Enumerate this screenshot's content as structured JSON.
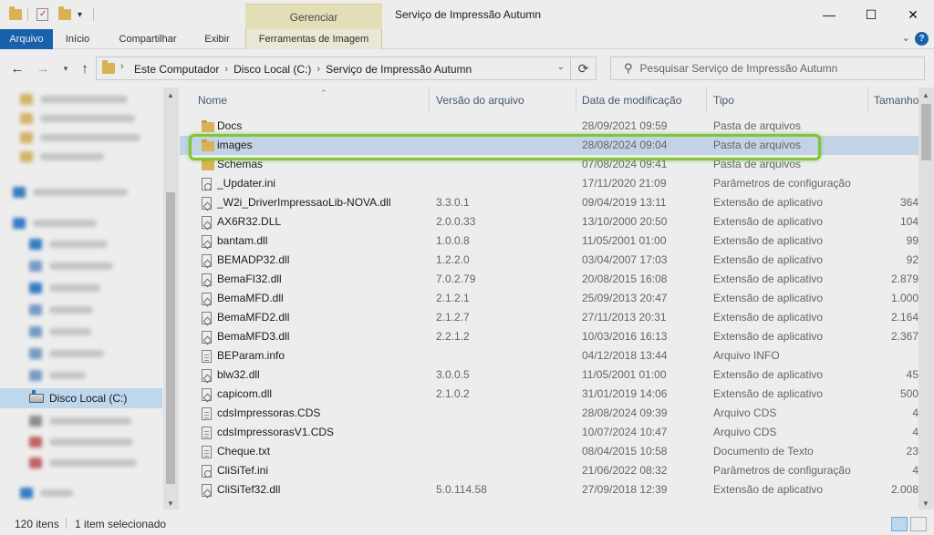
{
  "window": {
    "title": "Serviço de Impressão Autumn",
    "context_group": "Gerenciar",
    "minimize": "—",
    "maximize": "☐",
    "close": "✕"
  },
  "ribbon": {
    "tabs": [
      "Arquivo",
      "Início",
      "Compartilhar",
      "Exibir",
      "Ferramentas de Imagem"
    ],
    "help": "?"
  },
  "address": {
    "crumbs": [
      "Este Computador",
      "Disco Local (C:)",
      "Serviço de Impressão Autumn"
    ]
  },
  "search": {
    "placeholder": "Pesquisar Serviço de Impressão Autumn"
  },
  "sidebar": {
    "selected_item": "Disco Local (C:)"
  },
  "columns": [
    "Nome",
    "Versão do arquivo",
    "Data de modificação",
    "Tipo",
    "Tamanho"
  ],
  "files": [
    {
      "name": "Docs",
      "ver": "",
      "date": "28/09/2021 09:59",
      "type": "Pasta de arquivos",
      "size": "",
      "icon": "folder"
    },
    {
      "name": "images",
      "ver": "",
      "date": "28/08/2024 09:04",
      "type": "Pasta de arquivos",
      "size": "",
      "icon": "folder"
    },
    {
      "name": "Schemas",
      "ver": "",
      "date": "07/08/2024 09:41",
      "type": "Pasta de arquivos",
      "size": "",
      "icon": "folder"
    },
    {
      "name": "_Updater.ini",
      "ver": "",
      "date": "17/11/2020 21:09",
      "type": "Parâmetros de configuração",
      "size": "",
      "icon": "gear"
    },
    {
      "name": "_W2i_DriverImpressaoLib-NOVA.dll",
      "ver": "3.3.0.1",
      "date": "09/04/2019 13:11",
      "type": "Extensão de aplicativo",
      "size": "364",
      "icon": "dll"
    },
    {
      "name": "AX6R32.DLL",
      "ver": "2.0.0.33",
      "date": "13/10/2000 20:50",
      "type": "Extensão de aplicativo",
      "size": "104",
      "icon": "dll"
    },
    {
      "name": "bantam.dll",
      "ver": "1.0.0.8",
      "date": "11/05/2001 01:00",
      "type": "Extensão de aplicativo",
      "size": "99",
      "icon": "dll"
    },
    {
      "name": "BEMADP32.dll",
      "ver": "1.2.2.0",
      "date": "03/04/2007 17:03",
      "type": "Extensão de aplicativo",
      "size": "92",
      "icon": "dll"
    },
    {
      "name": "BemaFI32.dll",
      "ver": "7.0.2.79",
      "date": "20/08/2015 16:08",
      "type": "Extensão de aplicativo",
      "size": "2.879",
      "icon": "dll"
    },
    {
      "name": "BemaMFD.dll",
      "ver": "2.1.2.1",
      "date": "25/09/2013 20:47",
      "type": "Extensão de aplicativo",
      "size": "1.000",
      "icon": "dll"
    },
    {
      "name": "BemaMFD2.dll",
      "ver": "2.1.2.7",
      "date": "27/11/2013 20:31",
      "type": "Extensão de aplicativo",
      "size": "2.164",
      "icon": "dll"
    },
    {
      "name": "BemaMFD3.dll",
      "ver": "2.2.1.2",
      "date": "10/03/2016 16:13",
      "type": "Extensão de aplicativo",
      "size": "2.367",
      "icon": "dll"
    },
    {
      "name": "BEParam.info",
      "ver": "",
      "date": "04/12/2018 13:44",
      "type": "Arquivo INFO",
      "size": "",
      "icon": "file"
    },
    {
      "name": "blw32.dll",
      "ver": "3.0.0.5",
      "date": "11/05/2001 01:00",
      "type": "Extensão de aplicativo",
      "size": "45",
      "icon": "dll"
    },
    {
      "name": "capicom.dll",
      "ver": "2.1.0.2",
      "date": "31/01/2019 14:06",
      "type": "Extensão de aplicativo",
      "size": "500",
      "icon": "dll"
    },
    {
      "name": "cdsImpressoras.CDS",
      "ver": "",
      "date": "28/08/2024 09:39",
      "type": "Arquivo CDS",
      "size": "4",
      "icon": "file"
    },
    {
      "name": "cdsImpressorasV1.CDS",
      "ver": "",
      "date": "10/07/2024 10:47",
      "type": "Arquivo CDS",
      "size": "4",
      "icon": "file"
    },
    {
      "name": "Cheque.txt",
      "ver": "",
      "date": "08/04/2015 10:58",
      "type": "Documento de Texto",
      "size": "23",
      "icon": "file"
    },
    {
      "name": "CliSiTef.ini",
      "ver": "",
      "date": "21/06/2022 08:32",
      "type": "Parâmetros de configuração",
      "size": "4",
      "icon": "gear"
    },
    {
      "name": "CliSiTef32.dll",
      "ver": "5.0.114.58",
      "date": "27/09/2018 12:39",
      "type": "Extensão de aplicativo",
      "size": "2.008",
      "icon": "dll"
    }
  ],
  "status": {
    "count": "120 itens",
    "selected": "1 item selecionado"
  }
}
